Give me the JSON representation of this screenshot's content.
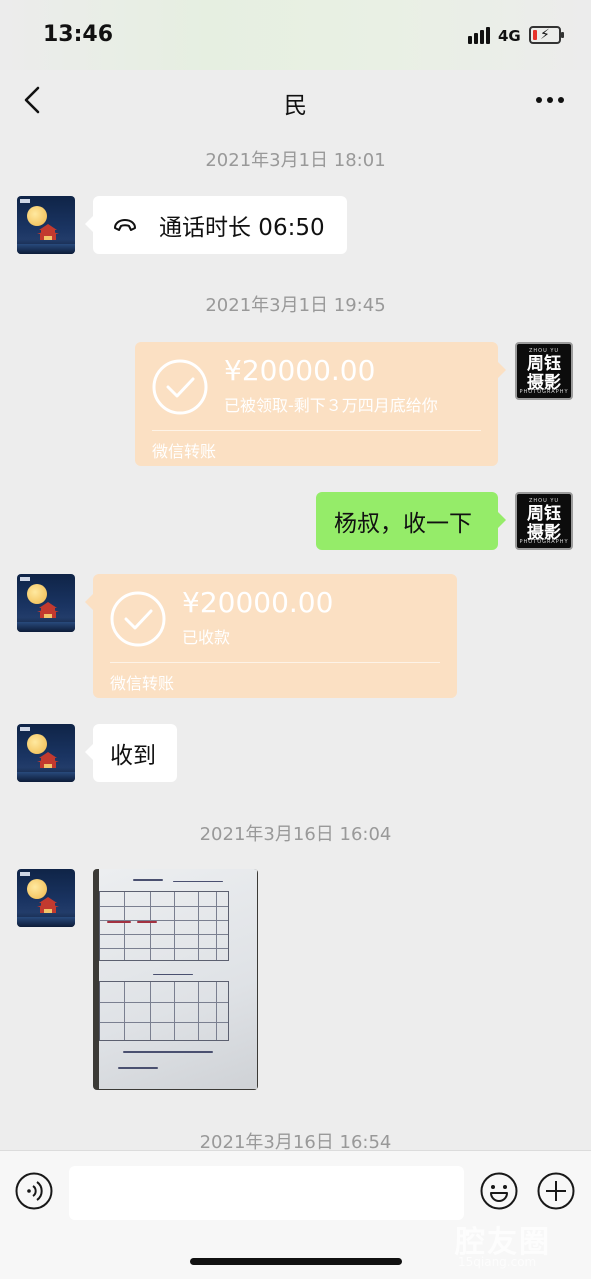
{
  "status_bar": {
    "time": "13:46",
    "network": "4G",
    "battery_level": 0.15,
    "battery_color": "#e6332a"
  },
  "nav": {
    "back_icon": "chevron-left-icon",
    "title": "民",
    "more_icon": "more-dots-icon"
  },
  "messages": [
    {
      "type": "timestamp",
      "text": "2021年3月1日 18:01"
    },
    {
      "type": "call",
      "side": "left",
      "icon": "phone-hangup-icon",
      "text": "通话时长 06:50"
    },
    {
      "type": "timestamp",
      "text": "2021年3月1日 19:45"
    },
    {
      "type": "transfer",
      "side": "right",
      "amount": "¥20000.00",
      "note": "已被领取-剩下３万四月底给你",
      "footer": "微信转账"
    },
    {
      "type": "text",
      "side": "right",
      "text": "杨叔，收一下"
    },
    {
      "type": "transfer",
      "side": "left",
      "amount": "¥20000.00",
      "note": "已收款",
      "footer": "微信转账"
    },
    {
      "type": "text",
      "side": "left",
      "text": "收到"
    },
    {
      "type": "timestamp",
      "text": "2021年3月16日 16:04"
    },
    {
      "type": "image",
      "side": "left",
      "description_icon": "document-photo-icon"
    },
    {
      "type": "timestamp",
      "text": "2021年3月16日 16:54"
    }
  ],
  "avatars": {
    "contact": "moon-pavilion-avatar",
    "self": {
      "top": "ZHOU YU",
      "main": "周钰\n摄影",
      "bottom": "PHOTOGRAPHY"
    }
  },
  "input_bar": {
    "voice_icon": "voice-icon",
    "emoji_icon": "emoji-icon",
    "plus_icon": "plus-icon",
    "placeholder": ""
  },
  "watermark": {
    "text": "腔友圈",
    "sub": "15qiang.com"
  },
  "colors": {
    "background": "#ededed",
    "self_bubble": "#95ec69",
    "transfer_bubble": "#fbe0c3"
  }
}
